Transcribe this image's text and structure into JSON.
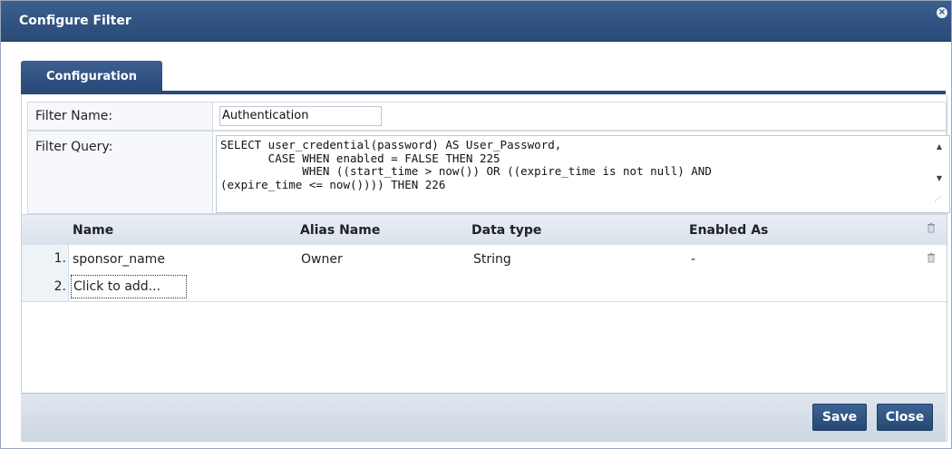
{
  "dialog": {
    "title": "Configure Filter"
  },
  "tabs": [
    {
      "label": "Configuration",
      "active": true
    }
  ],
  "form": {
    "filter_name_label": "Filter Name:",
    "filter_name_value": "Authentication",
    "filter_query_label": "Filter Query:",
    "filter_query_value": "SELECT user_credential(password) AS User_Password,\n       CASE WHEN enabled = FALSE THEN 225\n            WHEN ((start_time > now()) OR ((expire_time is not null) AND\n(expire_time <= now()))) THEN 226"
  },
  "grid": {
    "headers": [
      "Name",
      "Alias Name",
      "Data type",
      "Enabled As"
    ],
    "rows": [
      {
        "num": "1.",
        "name": "sponsor_name",
        "alias": "Owner",
        "type": "String",
        "enabled_as": "-"
      }
    ],
    "add_row": {
      "num": "2.",
      "placeholder": "Click to add..."
    }
  },
  "footer": {
    "save_label": "Save",
    "close_label": "Close"
  },
  "colors": {
    "header_blue": "#2a4a78",
    "footer_bg": "#dfe6ee"
  }
}
